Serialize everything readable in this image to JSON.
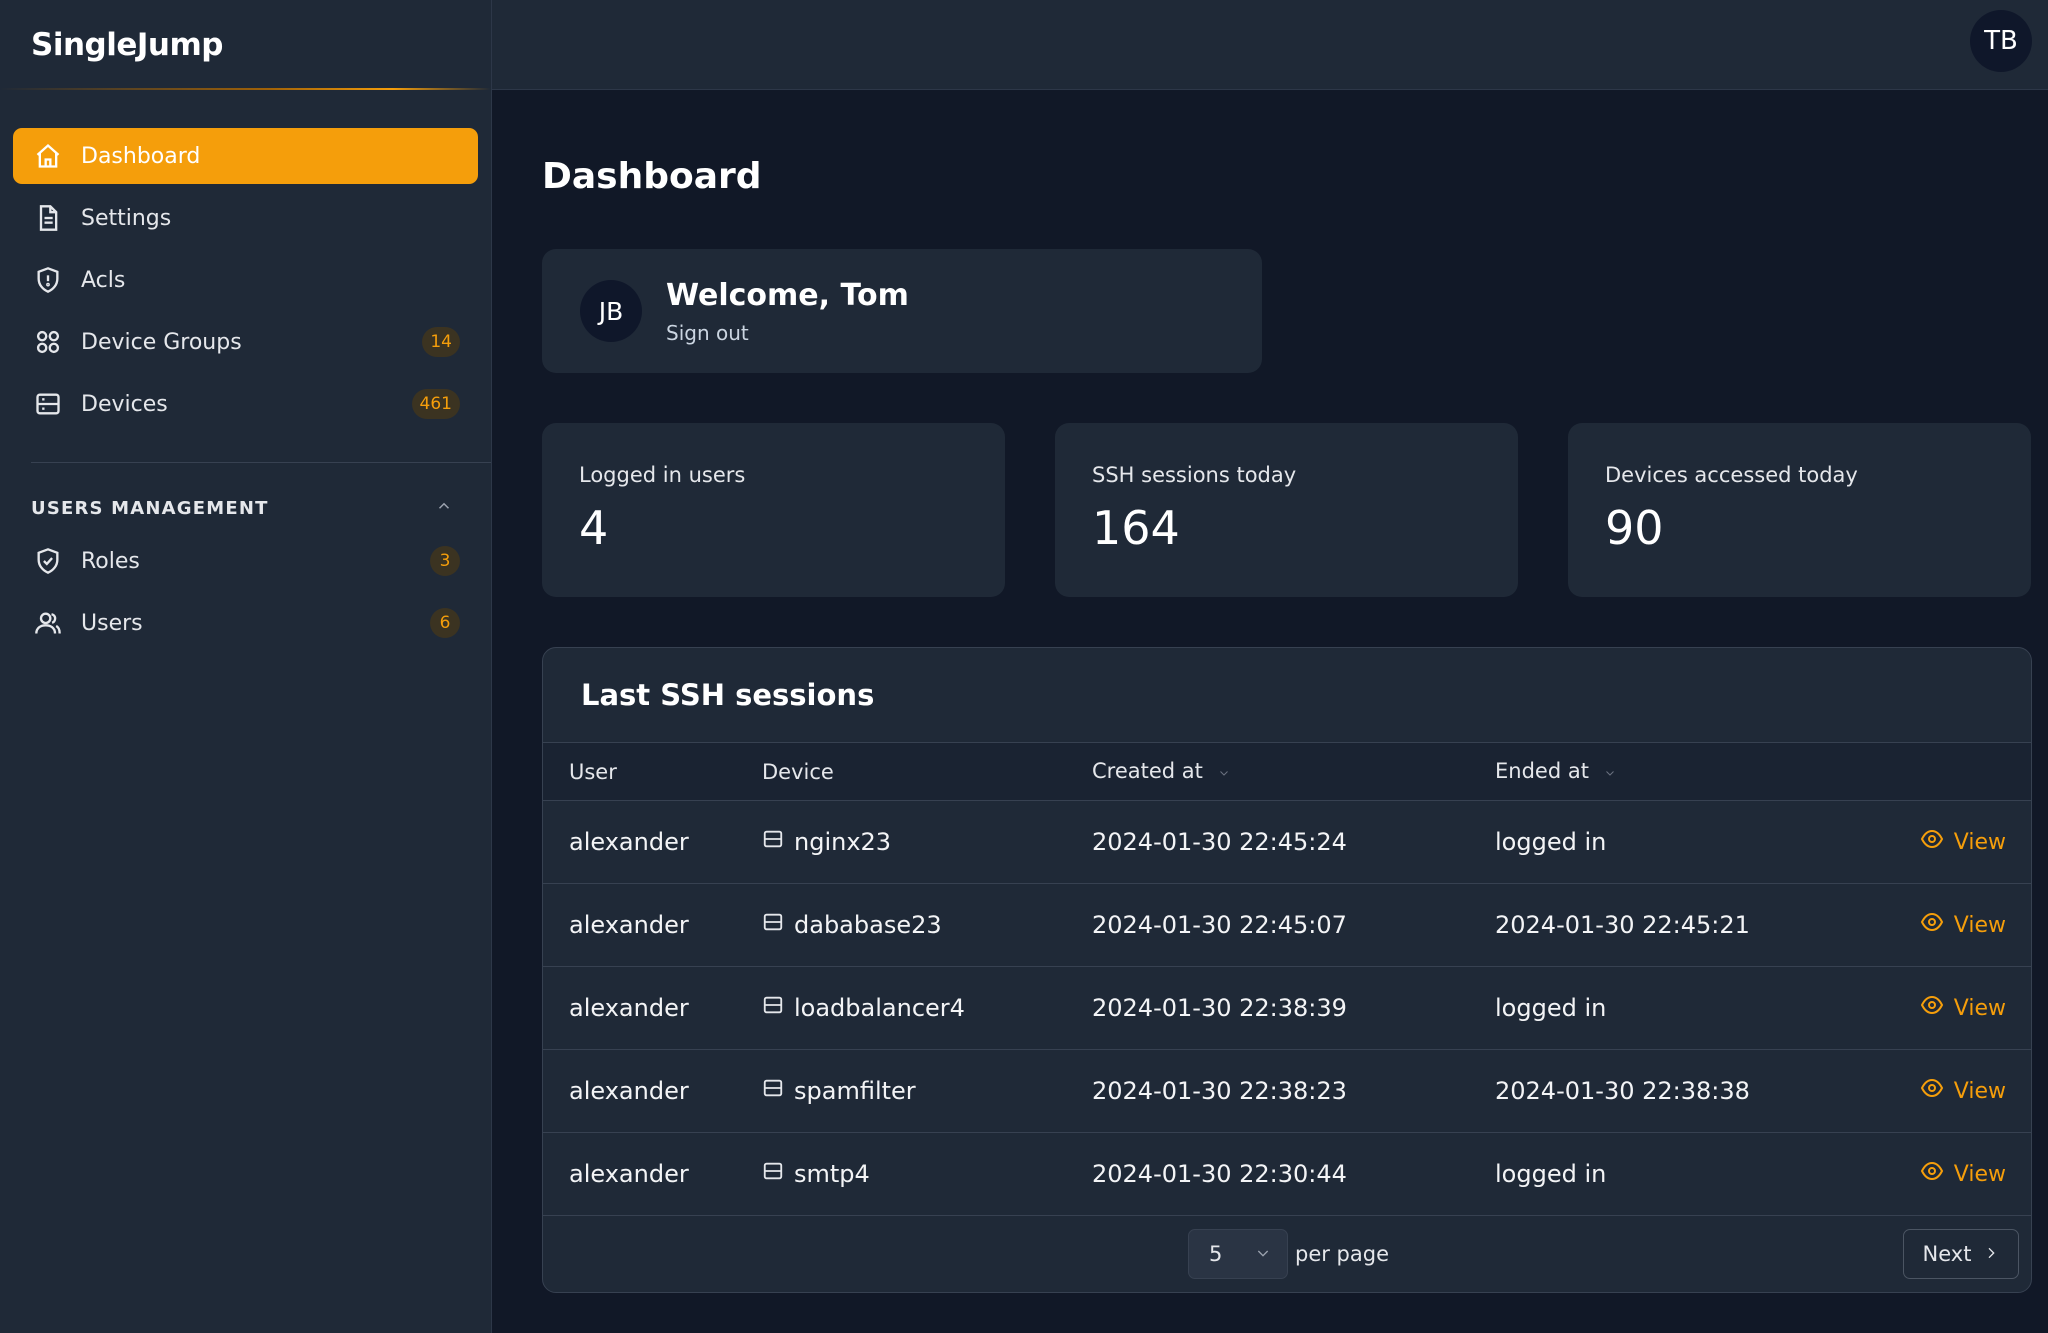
{
  "brand": "SingleJump",
  "topbar": {
    "avatar_initials": "TB"
  },
  "sidebar": {
    "items": [
      {
        "label": "Dashboard",
        "icon": "home-icon",
        "badge": null,
        "active": true
      },
      {
        "label": "Settings",
        "icon": "document-icon",
        "badge": null
      },
      {
        "label": "Acls",
        "icon": "shield-icon",
        "badge": null
      },
      {
        "label": "Device Groups",
        "icon": "grid-icon",
        "badge": "14"
      },
      {
        "label": "Devices",
        "icon": "server-icon",
        "badge": "461"
      }
    ],
    "section_title": "USERS MANAGEMENT",
    "section_items": [
      {
        "label": "Roles",
        "icon": "shield-check-icon",
        "badge": "3"
      },
      {
        "label": "Users",
        "icon": "users-icon",
        "badge": "6"
      }
    ]
  },
  "main": {
    "title": "Dashboard",
    "welcome": {
      "avatar_initials": "JB",
      "title": "Welcome, Tom",
      "signout": "Sign out"
    },
    "stats": [
      {
        "label": "Logged in users",
        "value": "4"
      },
      {
        "label": "SSH sessions today",
        "value": "164"
      },
      {
        "label": "Devices accessed today",
        "value": "90"
      }
    ],
    "sessions": {
      "title": "Last SSH sessions",
      "headers": {
        "user": "User",
        "device": "Device",
        "created": "Created at",
        "ended": "Ended at"
      },
      "rows": [
        {
          "user": "alexander",
          "device": "nginx23",
          "created": "2024-01-30 22:45:24",
          "ended": "logged in",
          "action": "View"
        },
        {
          "user": "alexander",
          "device": "dababase23",
          "created": "2024-01-30 22:45:07",
          "ended": "2024-01-30 22:45:21",
          "action": "View"
        },
        {
          "user": "alexander",
          "device": "loadbalancer4",
          "created": "2024-01-30 22:38:39",
          "ended": "logged in",
          "action": "View"
        },
        {
          "user": "alexander",
          "device": "spamfilter",
          "created": "2024-01-30 22:38:23",
          "ended": "2024-01-30 22:38:38",
          "action": "View"
        },
        {
          "user": "alexander",
          "device": "smtp4",
          "created": "2024-01-30 22:30:44",
          "ended": "logged in",
          "action": "View"
        }
      ],
      "pagination": {
        "per_page_value": "5",
        "per_page_label": "per page",
        "next_label": "Next"
      }
    }
  },
  "colors": {
    "accent": "#f59e0b",
    "background": "#111827",
    "surface": "#1f2937"
  }
}
